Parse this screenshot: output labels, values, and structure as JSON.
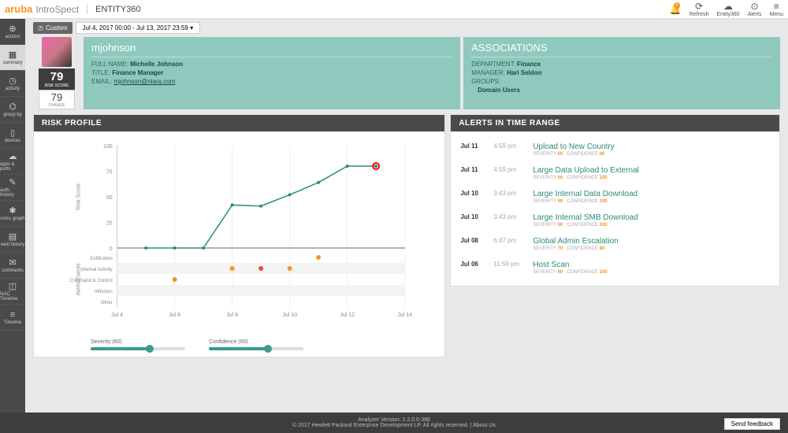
{
  "brand": {
    "name": "aruba",
    "sub": "IntroSpect",
    "app": "ENTITY360"
  },
  "topbar": {
    "notif_count": "0",
    "icons": [
      {
        "label": "",
        "glyph": "🔔"
      },
      {
        "label": "Refresh",
        "glyph": "⟳"
      },
      {
        "label": "Entity360",
        "glyph": "☁"
      },
      {
        "label": "Alerts",
        "glyph": "⊙"
      },
      {
        "label": "Menu",
        "glyph": "≡"
      }
    ]
  },
  "sidebar": {
    "items": [
      {
        "label": "actions",
        "glyph": "⊕"
      },
      {
        "label": "summary",
        "glyph": "▦"
      },
      {
        "label": "activity",
        "glyph": "◷"
      },
      {
        "label": "group by",
        "glyph": "⌬"
      },
      {
        "label": "devices",
        "glyph": "▯"
      },
      {
        "label": "apps & ports",
        "glyph": "☁"
      },
      {
        "label": "auth. history",
        "glyph": "✎"
      },
      {
        "label": "conv. graph",
        "glyph": "✱"
      },
      {
        "label": "web history",
        "glyph": "▤"
      },
      {
        "label": "comments",
        "glyph": "✉"
      },
      {
        "label": "NAC Timeline",
        "glyph": "◫"
      },
      {
        "label": "Timeline",
        "glyph": "≡"
      }
    ],
    "active_index": 1
  },
  "timerange": {
    "mode": "Custom",
    "range": "Jul 4, 2017 00:00 - Jul 13, 2017 23:59 ▾"
  },
  "profile": {
    "username": "mjohnson",
    "risk_score": "79",
    "risk_label": "RISK SCORE",
    "change_score": "79",
    "change_label": "CHANGE",
    "fullname_label": "FULL NAME:",
    "fullname": "Michelle Johnson",
    "title_label": "TITLE:",
    "title": "Finance Manager",
    "email_label": "EMAIL:",
    "email": "mjohnson@niara.com"
  },
  "associations": {
    "heading": "ASSOCIATIONS",
    "dept_label": "DEPARTMENT:",
    "dept": "Finance",
    "mgr_label": "MANAGER:",
    "mgr": "Hari Seldon",
    "groups_label": "GROUPS:",
    "groups": "Domain Users"
  },
  "risk_panel": {
    "heading": "RISK PROFILE",
    "ylabel": "Risk Score",
    "ylabel2": "Alerts/Events",
    "sliders": {
      "severity_label": "Severity (60)",
      "severity_pct": 60,
      "confidence_label": "Confidence (60)",
      "confidence_pct": 60
    }
  },
  "alerts_panel": {
    "heading": "ALERTS IN TIME RANGE",
    "sev_label": "SEVERITY",
    "conf_label": "CONFIDENCE",
    "items": [
      {
        "date": "Jul 11",
        "time": "4:59 pm",
        "title": "Upload to New Country",
        "sev": "60",
        "conf": "60"
      },
      {
        "date": "Jul 11",
        "time": "4:59 pm",
        "title": "Large Data Upload to External",
        "sev": "60",
        "conf": "100"
      },
      {
        "date": "Jul 10",
        "time": "3:43 pm",
        "title": "Large Internal Data Download",
        "sev": "60",
        "conf": "100"
      },
      {
        "date": "Jul 10",
        "time": "3:43 pm",
        "title": "Large Internal SMB Download",
        "sev": "60",
        "conf": "100"
      },
      {
        "date": "Jul 08",
        "time": "6:47 pm",
        "title": "Global Admin Escalation",
        "sev": "70",
        "conf": "80"
      },
      {
        "date": "Jul 06",
        "time": "11:59 pm",
        "title": "Host Scan",
        "sev": "60",
        "conf": "100"
      }
    ]
  },
  "footer": {
    "version": "Analyzer Version: 2.2.0.0-388",
    "copyright": "© 2017 Hewlett Packard Enterprise Development LP. All rights reserved.",
    "about": "About Us",
    "feedback": "Send feedback"
  },
  "chart_data": {
    "type": "line",
    "title": "",
    "xlabel": "",
    "ylabel": "Risk Score",
    "ylim": [
      0,
      100
    ],
    "x_ticks": [
      "Jul 4",
      "Jul 6",
      "Jul 8",
      "Jul 10",
      "Jul 12",
      "Jul 14"
    ],
    "line": {
      "x": [
        5,
        6,
        7,
        8,
        9,
        10,
        11,
        12,
        13
      ],
      "y": [
        0,
        0,
        0,
        42,
        41,
        52,
        64,
        80,
        80
      ]
    },
    "event_categories": [
      "Exfiltration",
      "Internal Activity",
      "Command & Control",
      "Infection",
      "Other"
    ],
    "events": [
      {
        "category": "Exfiltration",
        "x": 11,
        "sev": "normal"
      },
      {
        "category": "Internal Activity",
        "x": 8,
        "sev": "normal"
      },
      {
        "category": "Internal Activity",
        "x": 9,
        "sev": "high"
      },
      {
        "category": "Internal Activity",
        "x": 10,
        "sev": "normal"
      },
      {
        "category": "Command & Control",
        "x": 6,
        "sev": "normal"
      }
    ]
  }
}
